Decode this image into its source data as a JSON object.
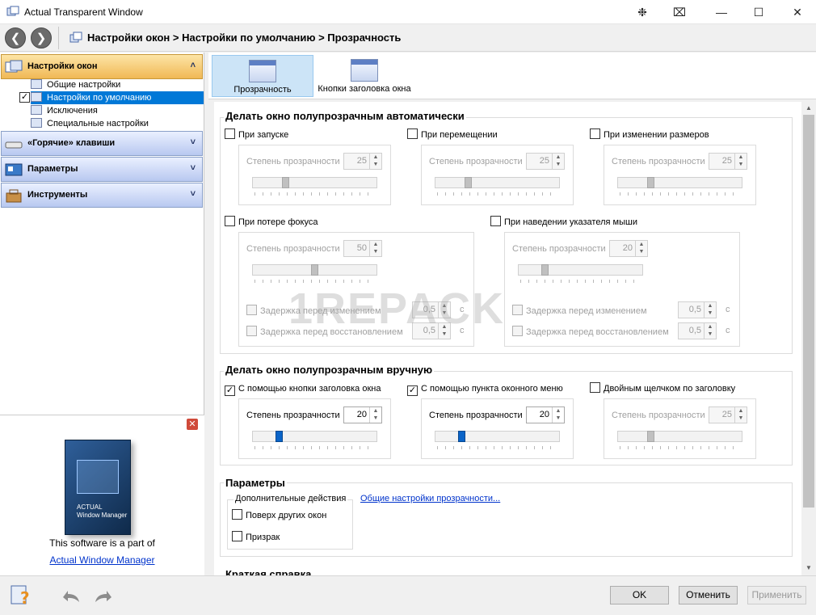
{
  "window": {
    "title": "Actual Transparent Window",
    "controls": [
      "❉",
      "⌧",
      "—",
      "☐",
      "✕"
    ]
  },
  "nav": {
    "back": "❮",
    "forward": "❯",
    "breadcrumb": "Настройки окон > Настройки по умолчанию > Прозрачность"
  },
  "sidebar": {
    "sections": [
      {
        "label": "Настройки окон",
        "chev": "˄"
      },
      {
        "label": "«Горячие» клавиши",
        "chev": "˅"
      },
      {
        "label": "Параметры",
        "chev": "˅"
      },
      {
        "label": "Инструменты",
        "chev": "˅"
      }
    ],
    "tree": [
      "Общие настройки",
      "Настройки по умолчанию",
      "Исключения",
      "Специальные настройки"
    ],
    "tree_check": "✓"
  },
  "promo": {
    "close": "✕",
    "line1": "This software is a part of",
    "link": "Actual Window Manager",
    "box_text": "ACTUAL\nWindow Manager"
  },
  "tabs": [
    "Прозрачность",
    "Кнопки заголовка окна"
  ],
  "auto": {
    "title": "Делать окно полупрозрачным автоматически",
    "opacity_label": "Степень прозрачности",
    "startup": {
      "label": "При запуске",
      "value": "25"
    },
    "move": {
      "label": "При перемещении",
      "value": "25"
    },
    "resize": {
      "label": "При изменении размеров",
      "value": "25"
    },
    "focus": {
      "label": "При потере фокуса",
      "value": "50"
    },
    "hover": {
      "label": "При наведении указателя мыши",
      "value": "20"
    },
    "delay_change": "Задержка перед изменением",
    "delay_restore": "Задержка перед восстановлением",
    "delay_value": "0,5",
    "unit": "с"
  },
  "manual": {
    "title": "Делать окно полупрозрачным вручную",
    "titlebtn": {
      "label": "С помощью кнопки заголовка окна",
      "value": "20"
    },
    "menu": {
      "label": "С помощью пункта оконного меню",
      "value": "20"
    },
    "dblclick": {
      "label": "Двойным щелчком по заголовку",
      "value": "25"
    },
    "check": "✓"
  },
  "params": {
    "title": "Параметры",
    "extra": "Дополнительные действия",
    "ontop": "Поверх других окон",
    "ghost": "Призрак",
    "link": "Общие настройки прозрачности..."
  },
  "help_title": "Краткая справка",
  "watermark": "1REPACK",
  "buttons": {
    "ok": "OK",
    "cancel": "Отменить",
    "apply": "Применить"
  },
  "spin_arrows": "▲\n▼",
  "scroll_up": "▲",
  "scroll_down": "▼"
}
